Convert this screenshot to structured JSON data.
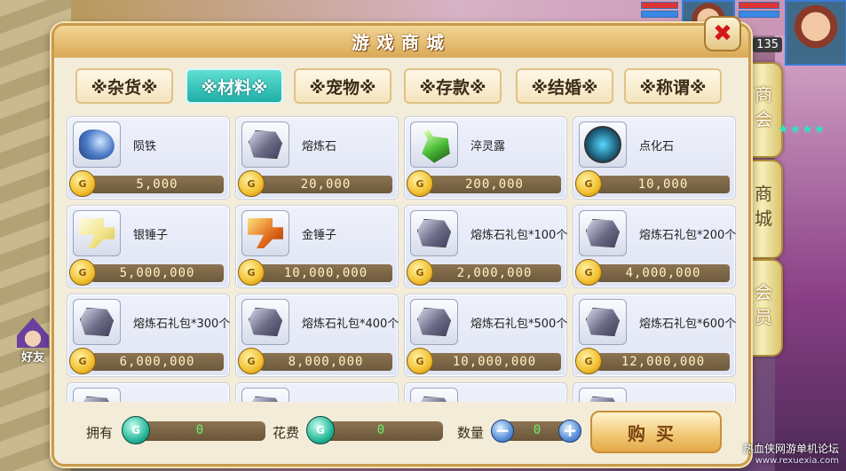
{
  "hud": {
    "level": "135",
    "friend_label": "好友",
    "watermark_text": "热血侠网游单机论坛",
    "watermark_url": "www.rexuexia.com"
  },
  "side_tabs": [
    {
      "label": "商会"
    },
    {
      "label": "商城",
      "active": true
    },
    {
      "label": "会员"
    }
  ],
  "stars": "★★★★",
  "shop": {
    "title": "游戏商城",
    "close_label": "✖",
    "tabs": [
      {
        "label": "※杂货※"
      },
      {
        "label": "※材料※",
        "active": true
      },
      {
        "label": "※宠物※"
      },
      {
        "label": "※存款※"
      },
      {
        "label": "※结婚※"
      },
      {
        "label": "※称谓※"
      }
    ],
    "items": [
      {
        "name": "陨铁",
        "price": "5,000",
        "icon": "meteorite-icon"
      },
      {
        "name": "熔炼石",
        "price": "20,000",
        "icon": "smelting-stone-icon"
      },
      {
        "name": "淬灵露",
        "price": "200,000",
        "icon": "potion-icon"
      },
      {
        "name": "点化石",
        "price": "10,000",
        "icon": "orb-icon"
      },
      {
        "name": "银锤子",
        "price": "5,000,000",
        "icon": "silver-hammer-icon"
      },
      {
        "name": "金锤子",
        "price": "10,000,000",
        "icon": "gold-hammer-icon"
      },
      {
        "name": "熔炼石礼包*100个",
        "price": "2,000,000",
        "icon": "smelting-stone-icon"
      },
      {
        "name": "熔炼石礼包*200个",
        "price": "4,000,000",
        "icon": "smelting-stone-icon"
      },
      {
        "name": "熔炼石礼包*300个",
        "price": "6,000,000",
        "icon": "smelting-stone-icon"
      },
      {
        "name": "熔炼石礼包*400个",
        "price": "8,000,000",
        "icon": "smelting-stone-icon"
      },
      {
        "name": "熔炼石礼包*500个",
        "price": "10,000,000",
        "icon": "smelting-stone-icon"
      },
      {
        "name": "熔炼石礼包*600个",
        "price": "12,000,000",
        "icon": "smelting-stone-icon"
      }
    ],
    "coin_glyph": "G",
    "footer": {
      "owned_label": "拥有",
      "owned_value": "0",
      "cost_label": "花费",
      "cost_value": "0",
      "qty_label": "数量",
      "qty_value": "0",
      "minus": "−",
      "plus": "+",
      "buy_label": "购买"
    }
  }
}
